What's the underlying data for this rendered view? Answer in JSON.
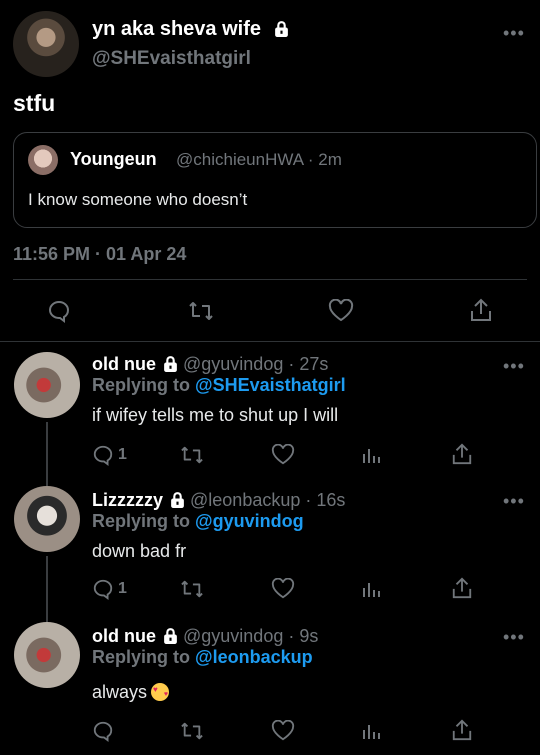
{
  "main_tweet": {
    "display_name": "yn aka sheva wife",
    "handle": "@SHEvaisthatgirl",
    "text": "stfu",
    "quote": {
      "display_name": "Youngeun",
      "handle_time": "@chichieunHWA · 2m",
      "text": "I know someone who doesn’t"
    },
    "timestamp": "11:56 PM · 01 Apr 24"
  },
  "replies": [
    {
      "display_name": "old nue",
      "handle_time": "@gyuvindog · 27s",
      "replying_label": "Replying to",
      "replying_to": "@SHEvaisthatgirl",
      "text": "if wifey tells me to shut up I will",
      "reply_count": "1"
    },
    {
      "display_name": "Lizzzzzy",
      "handle_time": "@leonbackup · 16s",
      "replying_label": "Replying to",
      "replying_to": "@gyuvindog",
      "text": "down bad fr",
      "reply_count": "1"
    },
    {
      "display_name": "old nue",
      "handle_time": "@gyuvindog · 9s",
      "replying_label": "Replying to",
      "replying_to": "@leonbackup",
      "text": "always",
      "emoji": "smiling-face-with-hearts",
      "reply_count": ""
    }
  ],
  "icons": {
    "reply": "speech-bubble-icon",
    "retweet": "retweet-icon",
    "like": "heart-icon",
    "analytics": "bar-chart-icon",
    "share": "share-icon",
    "lock": "lock-icon",
    "more": "more-dots-icon"
  },
  "colors": {
    "background": "#000000",
    "accent": "#1d9bf0",
    "muted": "#71767b"
  }
}
